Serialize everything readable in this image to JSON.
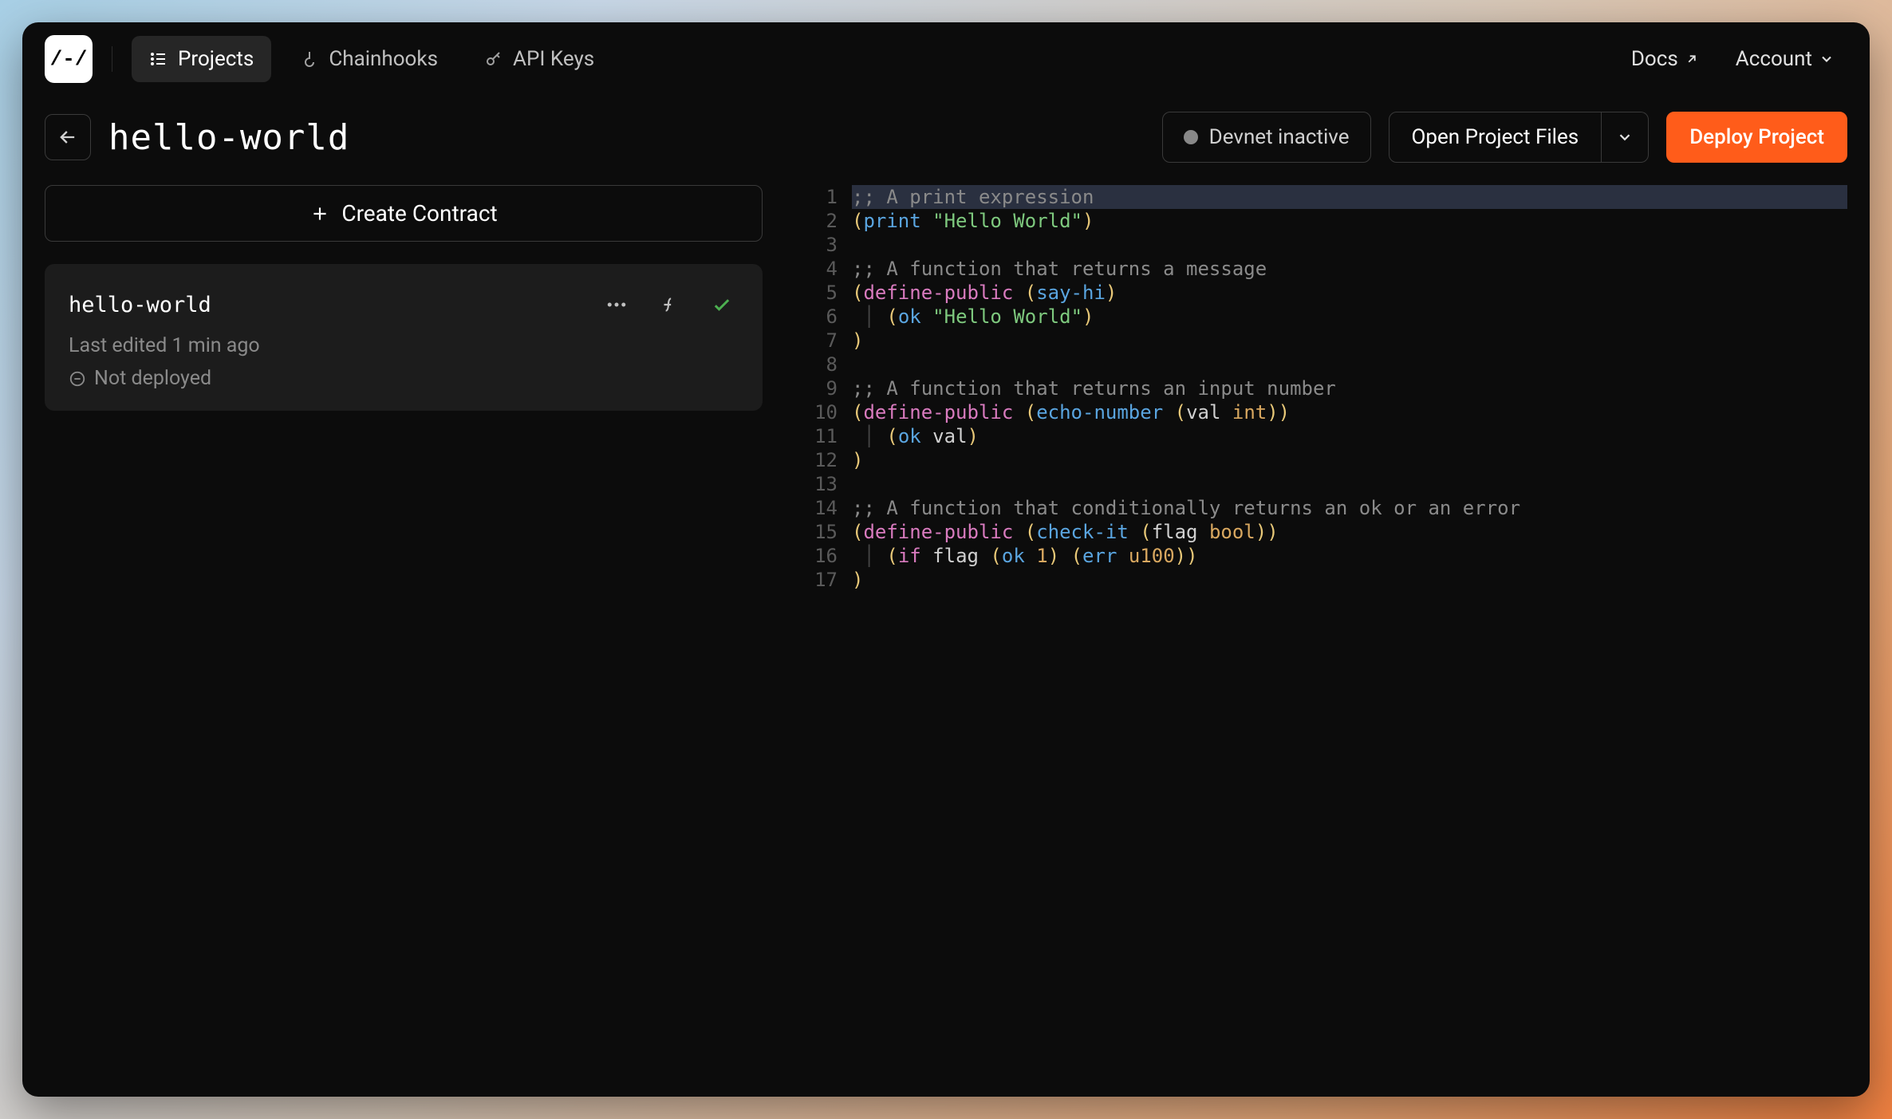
{
  "logo_text": "/-/",
  "nav": {
    "projects": "Projects",
    "chainhooks": "Chainhooks",
    "apikeys": "API Keys"
  },
  "top": {
    "docs": "Docs",
    "account": "Account"
  },
  "page": {
    "title": "hello-world"
  },
  "status": {
    "label": "Devnet inactive"
  },
  "buttons": {
    "open_files": "Open Project Files",
    "deploy": "Deploy Project",
    "create_contract": "Create Contract"
  },
  "contract": {
    "name": "hello-world",
    "last_edited": "Last edited 1 min ago",
    "deploy_status": "Not deployed"
  },
  "editor": {
    "lines": [
      {
        "n": 1,
        "hl": true,
        "tokens": [
          {
            "t": ";; A print expression",
            "c": "tok-comment"
          }
        ]
      },
      {
        "n": 2,
        "tokens": [
          {
            "t": "(",
            "c": "tok-paren"
          },
          {
            "t": "print",
            "c": "tok-fn"
          },
          {
            "t": " ",
            "c": ""
          },
          {
            "t": "\"Hello World\"",
            "c": "tok-string"
          },
          {
            "t": ")",
            "c": "tok-paren"
          }
        ]
      },
      {
        "n": 3,
        "tokens": []
      },
      {
        "n": 4,
        "tokens": [
          {
            "t": ";; A function that returns a message",
            "c": "tok-comment"
          }
        ]
      },
      {
        "n": 5,
        "tokens": [
          {
            "t": "(",
            "c": "tok-paren"
          },
          {
            "t": "define-public",
            "c": "tok-keyword"
          },
          {
            "t": " ",
            "c": ""
          },
          {
            "t": "(",
            "c": "tok-paren"
          },
          {
            "t": "say-hi",
            "c": "tok-fn"
          },
          {
            "t": ")",
            "c": "tok-paren"
          }
        ]
      },
      {
        "n": 6,
        "tokens": [
          {
            "t": " │ ",
            "c": "guide"
          },
          {
            "t": "(",
            "c": "tok-paren"
          },
          {
            "t": "ok",
            "c": "tok-fn"
          },
          {
            "t": " ",
            "c": ""
          },
          {
            "t": "\"Hello World\"",
            "c": "tok-string"
          },
          {
            "t": ")",
            "c": "tok-paren"
          }
        ]
      },
      {
        "n": 7,
        "tokens": [
          {
            "t": ")",
            "c": "tok-paren"
          }
        ]
      },
      {
        "n": 8,
        "tokens": []
      },
      {
        "n": 9,
        "tokens": [
          {
            "t": ";; A function that returns an input number",
            "c": "tok-comment"
          }
        ]
      },
      {
        "n": 10,
        "tokens": [
          {
            "t": "(",
            "c": "tok-paren"
          },
          {
            "t": "define-public",
            "c": "tok-keyword"
          },
          {
            "t": " ",
            "c": ""
          },
          {
            "t": "(",
            "c": "tok-paren"
          },
          {
            "t": "echo-number",
            "c": "tok-fn"
          },
          {
            "t": " ",
            "c": ""
          },
          {
            "t": "(",
            "c": "tok-paren"
          },
          {
            "t": "val",
            "c": "tok-ident"
          },
          {
            "t": " ",
            "c": ""
          },
          {
            "t": "int",
            "c": "tok-type"
          },
          {
            "t": "))",
            "c": "tok-paren"
          }
        ]
      },
      {
        "n": 11,
        "tokens": [
          {
            "t": " │ ",
            "c": "guide"
          },
          {
            "t": "(",
            "c": "tok-paren"
          },
          {
            "t": "ok",
            "c": "tok-fn"
          },
          {
            "t": " ",
            "c": ""
          },
          {
            "t": "val",
            "c": "tok-ident"
          },
          {
            "t": ")",
            "c": "tok-paren"
          }
        ]
      },
      {
        "n": 12,
        "tokens": [
          {
            "t": ")",
            "c": "tok-paren"
          }
        ]
      },
      {
        "n": 13,
        "tokens": []
      },
      {
        "n": 14,
        "tokens": [
          {
            "t": ";; A function that conditionally returns an ok or an error",
            "c": "tok-comment"
          }
        ]
      },
      {
        "n": 15,
        "tokens": [
          {
            "t": "(",
            "c": "tok-paren"
          },
          {
            "t": "define-public",
            "c": "tok-keyword"
          },
          {
            "t": " ",
            "c": ""
          },
          {
            "t": "(",
            "c": "tok-paren"
          },
          {
            "t": "check-it",
            "c": "tok-fn"
          },
          {
            "t": " ",
            "c": ""
          },
          {
            "t": "(",
            "c": "tok-paren"
          },
          {
            "t": "flag",
            "c": "tok-ident"
          },
          {
            "t": " ",
            "c": ""
          },
          {
            "t": "bool",
            "c": "tok-type"
          },
          {
            "t": "))",
            "c": "tok-paren"
          }
        ]
      },
      {
        "n": 16,
        "tokens": [
          {
            "t": " │ ",
            "c": "guide"
          },
          {
            "t": "(",
            "c": "tok-paren"
          },
          {
            "t": "if",
            "c": "tok-keyword"
          },
          {
            "t": " ",
            "c": ""
          },
          {
            "t": "flag",
            "c": "tok-ident"
          },
          {
            "t": " ",
            "c": ""
          },
          {
            "t": "(",
            "c": "tok-paren"
          },
          {
            "t": "ok",
            "c": "tok-fn"
          },
          {
            "t": " ",
            "c": ""
          },
          {
            "t": "1",
            "c": "tok-num"
          },
          {
            "t": ")",
            "c": "tok-paren"
          },
          {
            "t": " ",
            "c": ""
          },
          {
            "t": "(",
            "c": "tok-paren"
          },
          {
            "t": "err",
            "c": "tok-fn"
          },
          {
            "t": " ",
            "c": ""
          },
          {
            "t": "u100",
            "c": "tok-num"
          },
          {
            "t": "))",
            "c": "tok-paren"
          }
        ]
      },
      {
        "n": 17,
        "tokens": [
          {
            "t": ")",
            "c": "tok-paren"
          }
        ]
      }
    ]
  }
}
